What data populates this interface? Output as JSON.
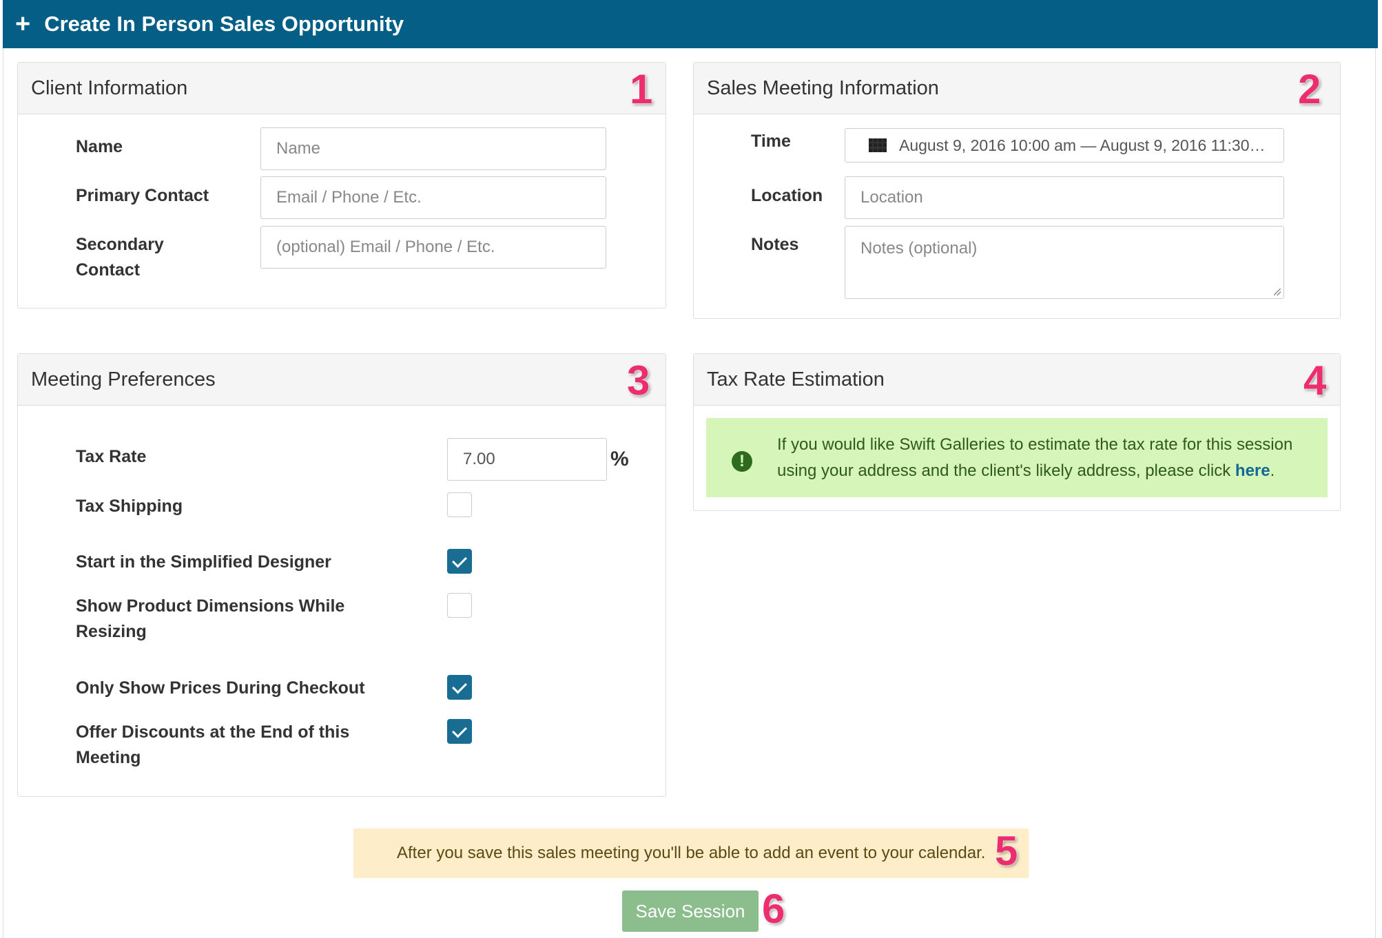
{
  "header": {
    "icon": "plus-icon",
    "title": "Create In Person Sales Opportunity",
    "bg_color": "#055e86"
  },
  "client_info": {
    "title": "Client Information",
    "badge": "1",
    "fields": [
      {
        "label": "Name",
        "placeholder": "Name"
      },
      {
        "label": "Primary Contact",
        "placeholder": "Email / Phone / Etc."
      },
      {
        "label_line1": "Secondary",
        "label_line2": "Contact",
        "placeholder": "(optional) Email / Phone / Etc."
      }
    ]
  },
  "sales_meeting": {
    "title": "Sales Meeting Information",
    "badge": "2",
    "time_label": "Time",
    "time_value": "August 9, 2016 10:00 am — August 9, 2016 11:30…",
    "time_icon": "calendar-icon",
    "location_label": "Location",
    "location_placeholder": "Location",
    "notes_label": "Notes",
    "notes_placeholder": "Notes (optional)"
  },
  "meeting_prefs": {
    "title": "Meeting Preferences",
    "badge": "3",
    "tax_rate_label": "Tax Rate",
    "tax_rate_value": "7.00",
    "percent_sign": "%",
    "options": [
      {
        "label": "Tax Shipping",
        "checked": false
      },
      {
        "label": "Start in the Simplified Designer",
        "checked": true
      },
      {
        "label_line1": "Show Product Dimensions While",
        "label_line2": "Resizing",
        "checked": false
      },
      {
        "label": "Only Show Prices During Checkout",
        "checked": true
      },
      {
        "label_line1": "Offer Discounts at the End of this",
        "label_line2": "Meeting",
        "checked": true
      }
    ],
    "check_color": "#1a6d92"
  },
  "tax_estimation": {
    "title": "Tax Rate Estimation",
    "badge": "4",
    "alert_icon": "exclamation-icon",
    "message_line1": "If you would like Swift Galleries to estimate the tax rate for this session",
    "message_line2": "using your address and the client's likely address, please click ",
    "link_text": "here",
    "message_end": "."
  },
  "calendar_notice": {
    "text": "After you save this sales meeting you'll be able to add an event to your calendar.",
    "badge": "5"
  },
  "save": {
    "label": "Save Session",
    "badge": "6",
    "color": "#8cbd8c"
  },
  "badge_color": "#ec2d6e"
}
